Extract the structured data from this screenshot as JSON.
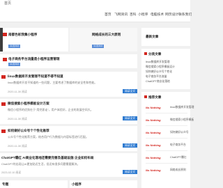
{
  "topbar": {
    "logo": "首页"
  },
  "nav": {
    "items": [
      "首页",
      "飞网资讯",
      "百科",
      "小程序",
      "电脑技术",
      "网页设计",
      "联系我们"
    ]
  },
  "featured": [
    {
      "title": "南都色彩我集小程序",
      "date": "11月302"
    },
    {
      "title": "网络成长的三大原则",
      "date": "11月302"
    }
  ],
  "wide_item": {
    "title": "电子商务平台流量是小程序运营管理",
    "date": "11月302"
  },
  "articles": [
    {
      "title": "linux数据库开发管理不知道不得不知道",
      "snippet": "linux数据库开发不知道的一些问题，主要考虑了数据库的安全性和性能。",
      "meta": "2020-11-30  阅读",
      "button": "阅读全文"
    },
    {
      "title": "微信搜索小程序模板设计方案",
      "snippet": "微信小程序的优势在于“用完即走”，用户体验好，企业的发展空间大。",
      "meta": "2020-11-30  阅读",
      "button": "阅读全文"
    },
    {
      "title": "如何做好公众号个个性化推荐",
      "snippet": "公众号个性化推荐方案，结合用户行为数据与内容标签进行匹配。",
      "meta": "2020-11-30  阅读",
      "button": "阅读全文"
    },
    {
      "title": "ChatGPT爆红 AI商业化落地还需要完善及基础设施 企业如何布局",
      "snippet": "ChatGPT的出现让AI更加贴近生活，但还有很多问题需要解决。",
      "meta": "2023-02-10  阅读",
      "button": "阅读全文"
    }
  ],
  "bottom_cards": [
    {
      "title": "专题"
    },
    {
      "title": "小程序"
    }
  ],
  "sidebar": {
    "title1": "最新文章",
    "section2": "分类文章",
    "items2": [
      "linux数据库开发管理",
      "微信搜索小程序模板设计",
      "如何做好公众号个性化",
      "电子商务平台流量",
      "ChatGPT商业化落地"
    ],
    "section3": "推荐文章",
    "nothing": "No Nothing",
    "rec": [
      "linux数据库开发管理",
      "微信搜索小程序模板",
      "如何做好公众号",
      "电子商务平台",
      "ChatGPT爆红",
      "网络成长原则"
    ]
  }
}
